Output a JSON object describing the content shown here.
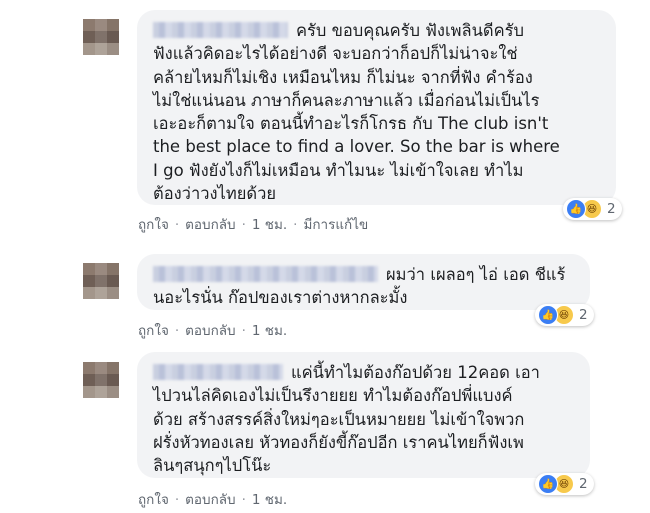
{
  "comments": [
    {
      "text_lines": [
        "ครับ ขอบคุณครับ ฟังเพลินดีครับ",
        "ฟังแล้วคิดอะไรได้อย่างดี จะบอกว่าก็อปก็ไม่น่าจะใช่",
        "คล้ายไหมก็ไม่เชิง เหมือนไหม ก็ไม่นะ จากที่ฟัง คำร้อง",
        "ไม่ใช่แน่นอน ภาษาก็คนละภาษาแล้ว เมื่อก่อนไม่เป็นไร",
        "เอะอะก็ตามใจ ตอนนี้ทำอะไรก็โกรธ กับ The club isn't",
        "the best place to find a lover. So the bar is where",
        "I go ฟังยังไงก็ไม่เหมือน ทำไมนะ ไม่เข้าใจเลย ทำไม",
        "ต้องว่าวงไทยด้วย"
      ],
      "actions": {
        "like": "ถูกใจ",
        "reply": "ตอบกลับ",
        "time": "1 ชม.",
        "edited": "มีการแก้ไข"
      },
      "reaction_count": "2"
    },
    {
      "text_lines": [
        "ผมว่า เผลอๆ ไอ่ เอด ชีแร้",
        "นอะไรนั่น ก๊อปของเราต่างหากละมั้ง"
      ],
      "actions": {
        "like": "ถูกใจ",
        "reply": "ตอบกลับ",
        "time": "1 ชม."
      },
      "reaction_count": "2"
    },
    {
      "text_lines": [
        "แค่นี้ทำไมต้องก๊อปด้วย 12คอด เอา",
        "ไปวนไล่คิดเองไม่เป็นรึงายยย ทำไมต้องก๊อปพี่แบงค์",
        "ด้วย สร้างสรรค์สิ่งใหม่ๆอะเป็นหมายยย ไม่เข้าใจพวก",
        "ฝรั่งหัวทองเลย หัวทองก็ยังขี้ก๊อปอีก เราคนไทยก็ฟังเพ",
        "ลินๆสนุกๆไปโน๊ะ"
      ],
      "actions": {
        "like": "ถูกใจ",
        "reply": "ตอบกลับ",
        "time": "1 ชม."
      },
      "reaction_count": "2"
    }
  ],
  "separator": "·",
  "icons": {
    "reaction_1": "like-icon",
    "reaction_2": "haha-icon"
  },
  "colors": {
    "bubble": "#f2f3f5",
    "meta": "#606770",
    "like": "#3b7ef4",
    "haha": "#f7c94c"
  }
}
